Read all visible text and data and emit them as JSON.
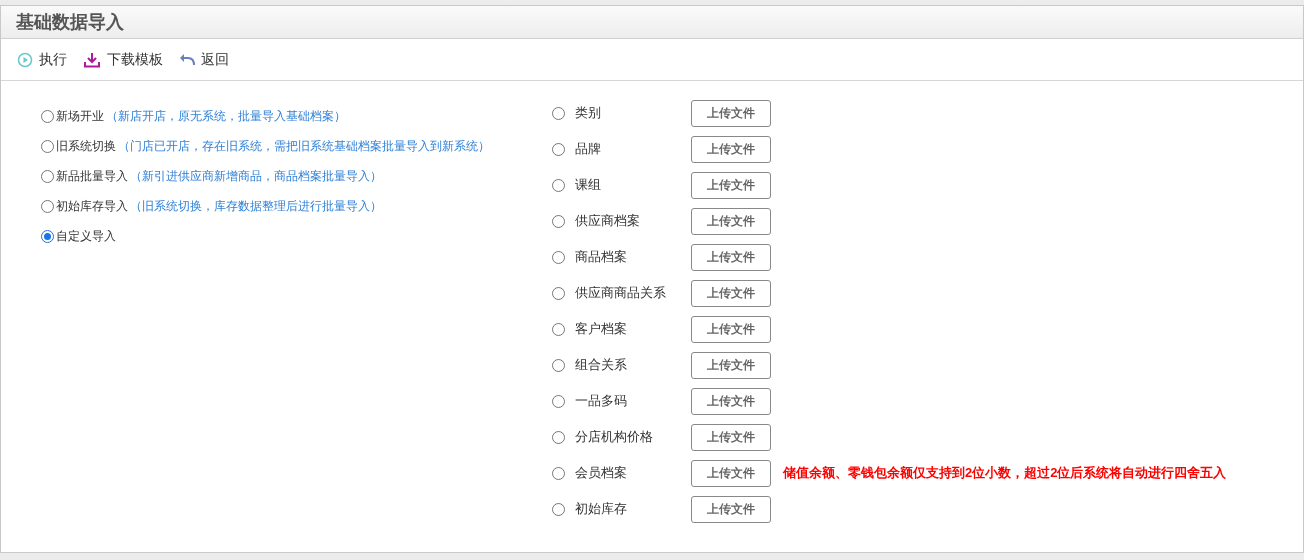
{
  "window": {
    "title": "基础数据导入"
  },
  "toolbar": [
    {
      "kind": "run",
      "label": "执行"
    },
    {
      "kind": "download",
      "label": "下载模板"
    },
    {
      "kind": "back",
      "label": "返回"
    }
  ],
  "modes": [
    {
      "label": "新场开业",
      "note": "（新店开店，原无系统，批量导入基础档案）",
      "selected": false
    },
    {
      "label": "旧系统切换",
      "note": "（门店已开店，存在旧系统，需把旧系统基础档案批量导入到新系统）",
      "selected": false
    },
    {
      "label": "新品批量导入",
      "note": "（新引进供应商新增商品，商品档案批量导入）",
      "selected": false
    },
    {
      "label": "初始库存导入",
      "note": "（旧系统切换，库存数据整理后进行批量导入）",
      "selected": false
    },
    {
      "label": "自定义导入",
      "selected": true
    }
  ],
  "import_items": [
    {
      "label": "类别",
      "selected": false,
      "button": "上传文件"
    },
    {
      "label": "品牌",
      "selected": false,
      "button": "上传文件"
    },
    {
      "label": "课组",
      "selected": false,
      "button": "上传文件"
    },
    {
      "label": "供应商档案",
      "selected": false,
      "button": "上传文件"
    },
    {
      "label": "商品档案",
      "selected": false,
      "button": "上传文件"
    },
    {
      "label": "供应商商品关系",
      "selected": false,
      "button": "上传文件"
    },
    {
      "label": "客户档案",
      "selected": false,
      "button": "上传文件"
    },
    {
      "label": "组合关系",
      "selected": false,
      "button": "上传文件"
    },
    {
      "label": "一品多码",
      "selected": false,
      "button": "上传文件"
    },
    {
      "label": "分店机构价格",
      "selected": false,
      "button": "上传文件"
    },
    {
      "label": "会员档案",
      "selected": false,
      "button": "上传文件",
      "warning": "储值余额、零钱包余额仅支持到2位小数，超过2位后系统将自动进行四舍五入"
    },
    {
      "label": "初始库存",
      "selected": false,
      "button": "上传文件"
    }
  ]
}
